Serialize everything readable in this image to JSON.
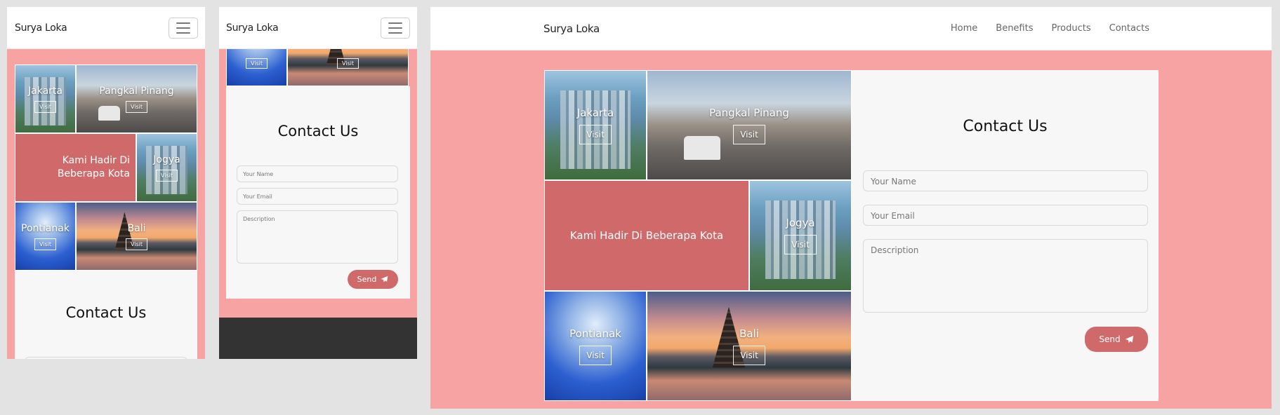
{
  "brand": "Surya Loka",
  "nav": {
    "items": [
      "Home",
      "Benefits",
      "Products",
      "Contacts"
    ]
  },
  "gallery": {
    "tagline": "Kami Hadir Di Beberapa Kota",
    "visit_label": "Visit",
    "cities": {
      "jakarta": "Jakarta",
      "pangkal_pinang": "Pangkal Pinang",
      "jogya": "Jogya",
      "pontianak": "Pontianak",
      "bali": "Bali"
    }
  },
  "contact": {
    "title": "Contact Us",
    "name_placeholder": "Your Name",
    "email_placeholder": "Your Email",
    "description_placeholder": "Description",
    "send_label": "Send"
  },
  "colors": {
    "page_background": "#f7a3a4",
    "accent_tile": "#d06a6a",
    "button": "#d06a6a",
    "footer": "#333333"
  },
  "icons": {
    "send": "paper-plane-icon",
    "menu": "hamburger-menu-icon"
  }
}
